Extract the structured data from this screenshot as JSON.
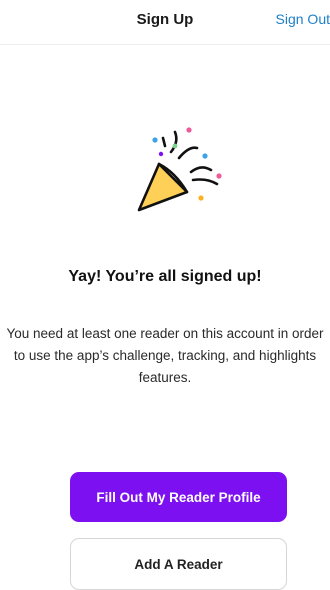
{
  "header": {
    "title": "Sign Up",
    "sign_out_label": "Sign Out"
  },
  "main": {
    "icon": "party-popper-icon",
    "headline": "Yay! You’re all signed up!",
    "body": "You need at least one reader on this account in order to use the app’s challenge, tracking, and highlights features."
  },
  "actions": {
    "primary_label": "Fill Out My Reader Profile",
    "secondary_label": "Add A Reader"
  },
  "colors": {
    "accent": "#7D10F0",
    "link": "#1F7FC7",
    "popper": "#FFD057",
    "confetti": [
      "#3DA2E8",
      "#F05A9A",
      "#7BD389",
      "#FFB020",
      "#7D10F0"
    ]
  }
}
